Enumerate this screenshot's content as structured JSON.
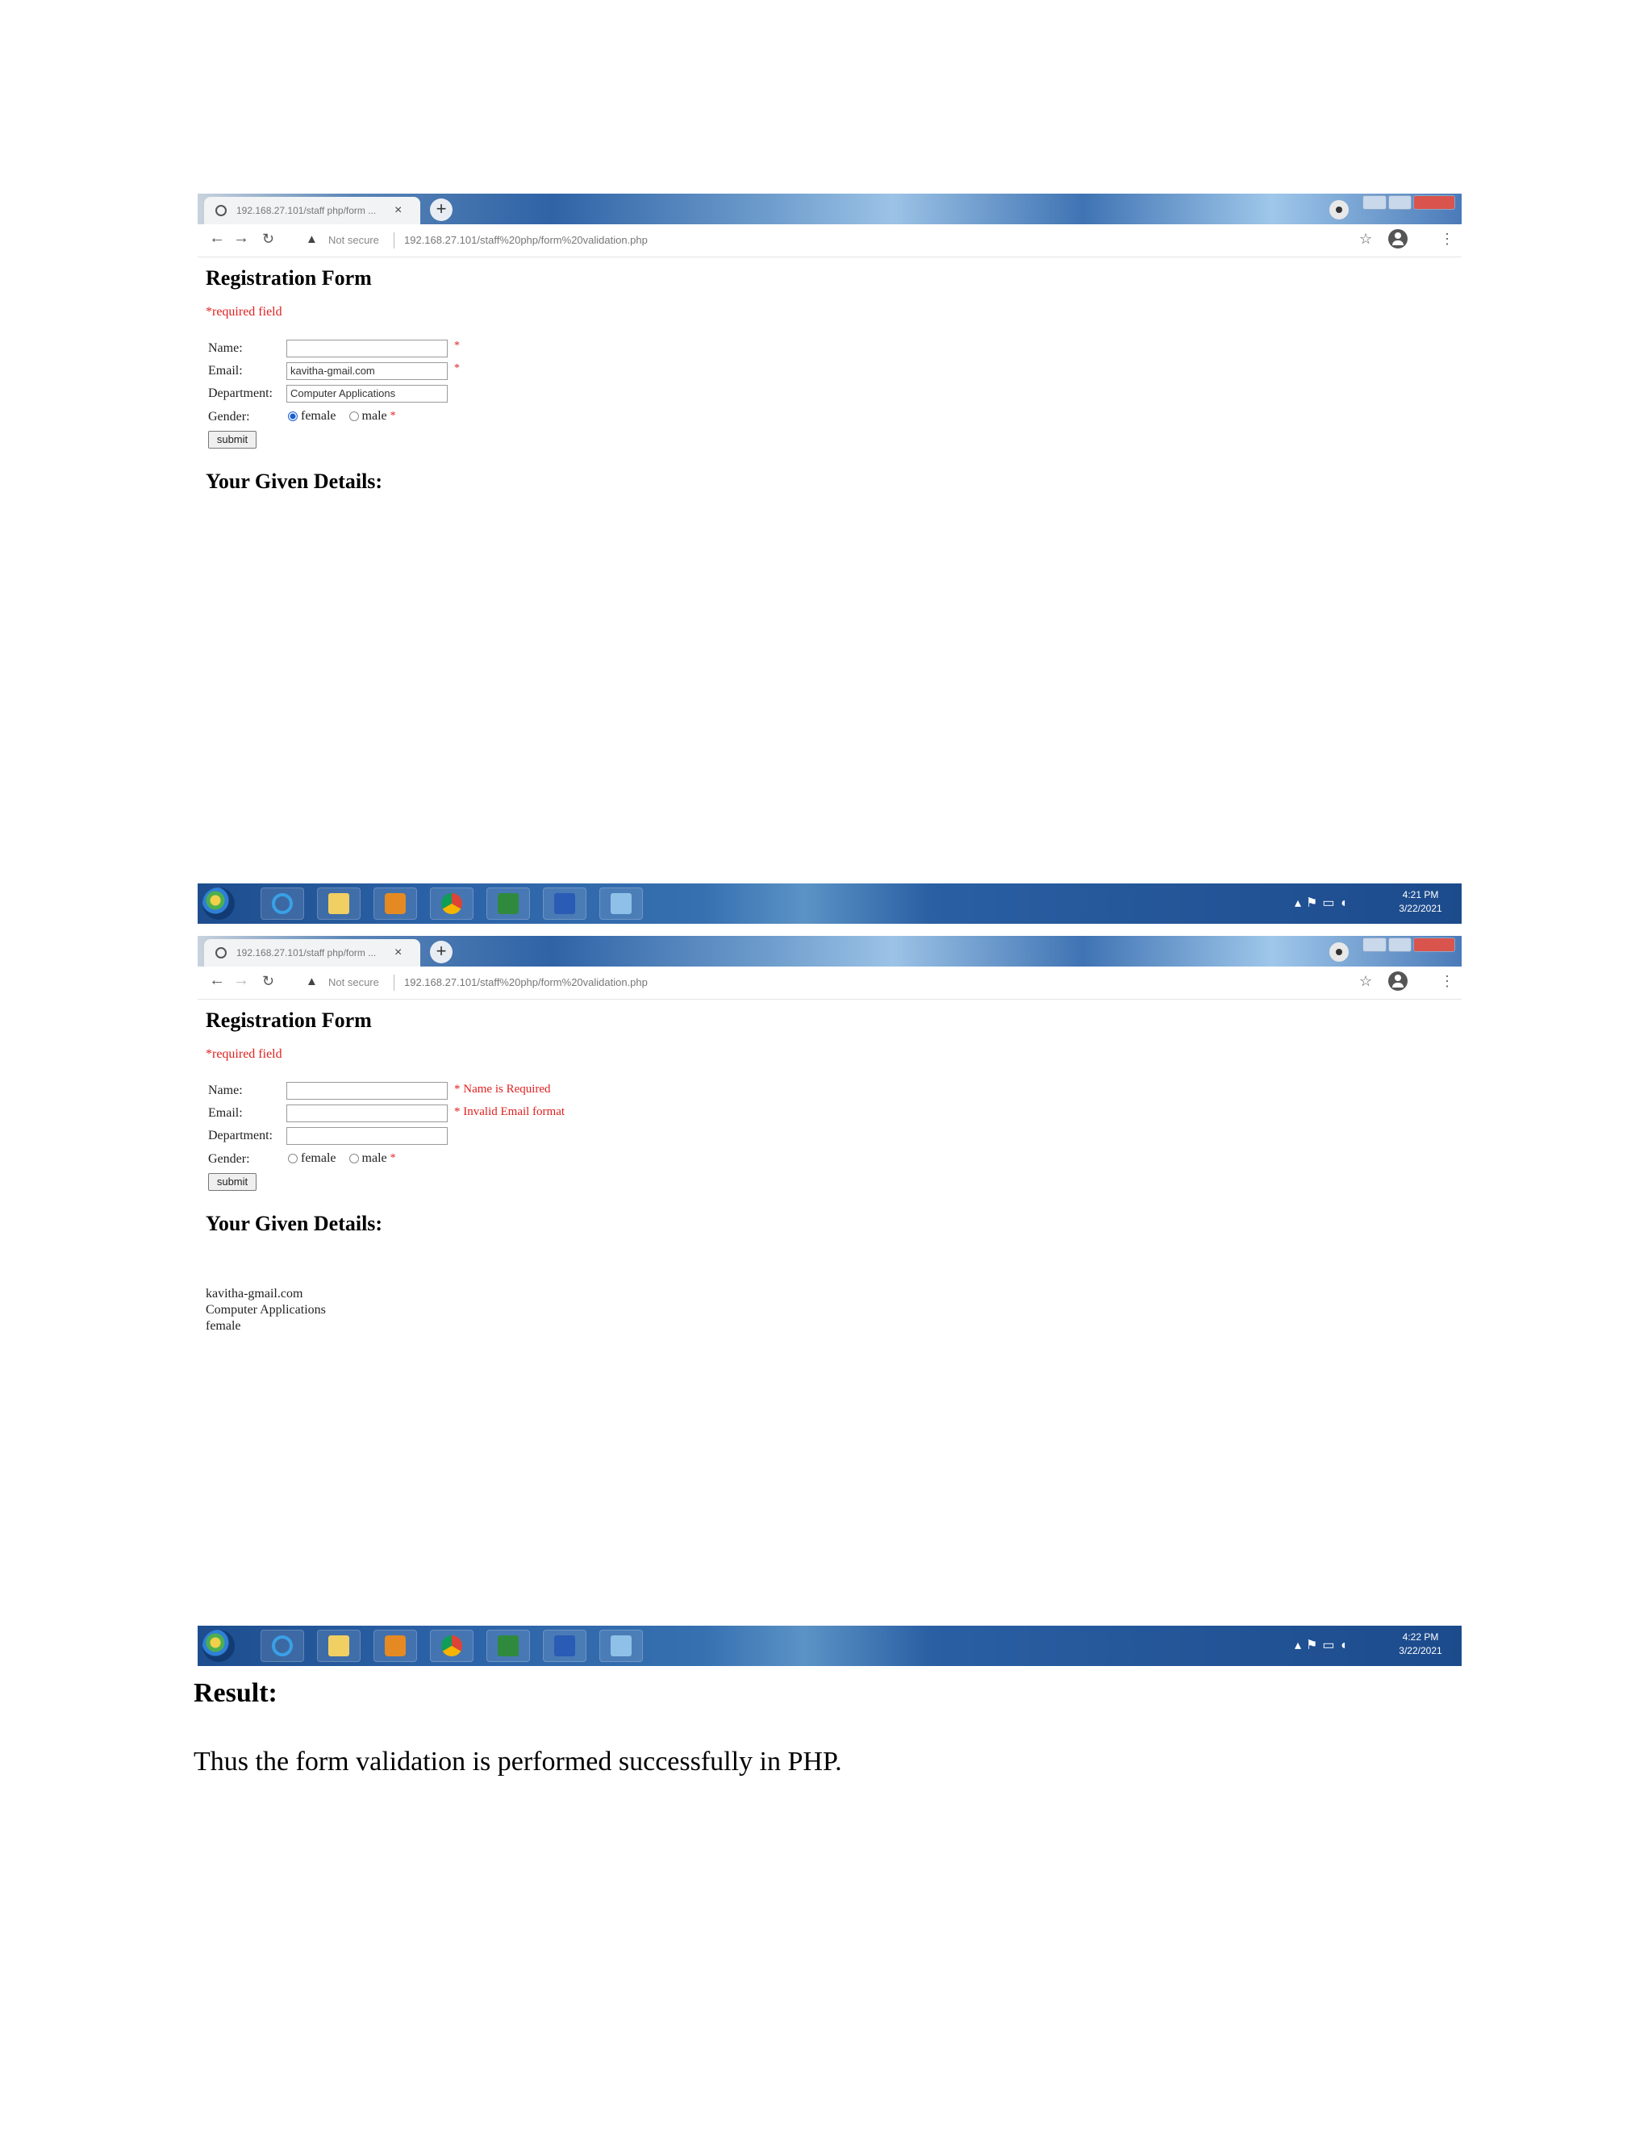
{
  "browser": {
    "tab_title": "192.168.27.101/staff php/form ...",
    "tab_close": "×",
    "new_tab": "+",
    "not_secure": "Not secure",
    "url": "192.168.27.101/staff%20php/form%20validation.php"
  },
  "screenshots": [
    {
      "page_title": "Registration Form",
      "required_note": "*required field",
      "labels": {
        "name": "Name:",
        "email": "Email:",
        "department": "Department:",
        "gender": "Gender:"
      },
      "values": {
        "name": "",
        "email": "kavitha-gmail.com",
        "department": "Computer Applications"
      },
      "name_error": "*",
      "email_error": "*",
      "gender_options": [
        "female",
        "male"
      ],
      "gender_selected": "female",
      "gender_required": "*",
      "submit_label": "submit",
      "details_heading": "Your Given Details:",
      "details": [
        "",
        "",
        ""
      ],
      "clock_time": "4:21 PM",
      "clock_date": "3/22/2021"
    },
    {
      "page_title": "Registration Form",
      "required_note": "*required field",
      "labels": {
        "name": "Name:",
        "email": "Email:",
        "department": "Department:",
        "gender": "Gender:"
      },
      "values": {
        "name": "",
        "email": "",
        "department": ""
      },
      "name_error": "* Name is Required",
      "email_error": "* Invalid Email format",
      "gender_options": [
        "female",
        "male"
      ],
      "gender_selected": "",
      "gender_required": "*",
      "submit_label": "submit",
      "details_heading": "Your Given Details:",
      "details": [
        "kavitha-gmail.com",
        "Computer Applications",
        "female"
      ],
      "clock_time": "4:22 PM",
      "clock_date": "3/22/2021"
    }
  ],
  "document": {
    "result_heading": "Result:",
    "conclusion": "Thus the form validation is performed successfully in PHP."
  }
}
